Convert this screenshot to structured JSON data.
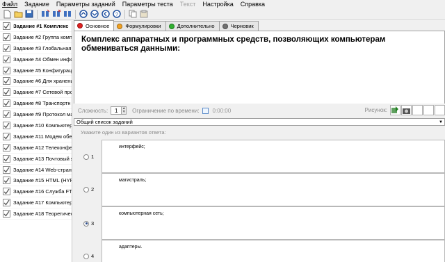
{
  "menu": [
    "Файл",
    "Задание",
    "Параметры заданий",
    "Параметры теста",
    "Текст",
    "Настройка",
    "Справка"
  ],
  "toolbar_icons": [
    "new-icon",
    "open-icon",
    "save-icon",
    "add-task-icon",
    "delete-task-icon",
    "move-task-icon",
    "arrow-up-icon",
    "arrow-down-icon",
    "arrow-left-icon",
    "help-icon",
    "copy-icon",
    "paste-icon"
  ],
  "tasks": [
    "Задание #1 Комплекс",
    "Задание #2 Группа комп",
    "Задание #3 Глобальная",
    "Задание #4 Обмен инфо",
    "Задание #5 Конфигурац",
    "Задание #6 Для хранени",
    "Задание #7 Сетевой про",
    "Задание #8 Транспортн",
    "Задание #9 Протокол ма",
    "Задание #10 Компьютер",
    "Задание #11 Модем обес",
    "Задание #12 Телеконфе",
    "Задание #13 Почтовый я",
    "Задание #14 Web-стран",
    "Задание #15 HTML (HYPE",
    "Задание #16 Служба FTI",
    "Задание #17 Компьютер",
    "Задание #18 Теоретичес"
  ],
  "tabs": [
    {
      "label": "Основное",
      "color": "#e02020"
    },
    {
      "label": "Формулировки",
      "color": "#f0a020"
    },
    {
      "label": "Дополнительно",
      "color": "#30b030"
    },
    {
      "label": "Черновик",
      "color": "#707070"
    }
  ],
  "question_text": "Комплекс аппаратных и программных средств, позволяющих компьютерам обмениваться данными:",
  "params": {
    "difficulty_label": "Сложность:",
    "difficulty_value": "1",
    "time_limit_label": "Ограничение по времени:",
    "time_value": "0:00:00",
    "picture_label": "Рисунок:"
  },
  "dropdown_value": "Общий список заданий",
  "answers_prompt": "Укажите один из вариантов ответа:",
  "answers": [
    {
      "num": "1",
      "text": "интерфейс;"
    },
    {
      "num": "2",
      "text": "магистраль;"
    },
    {
      "num": "3",
      "text": "компьютерная сеть;"
    },
    {
      "num": "4",
      "text": "адаптеры."
    }
  ]
}
